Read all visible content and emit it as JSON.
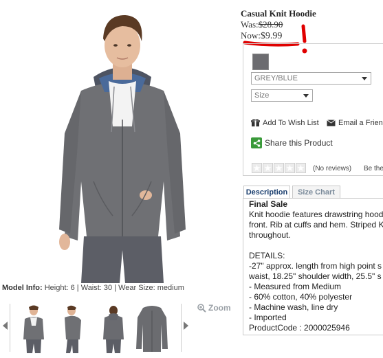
{
  "product": {
    "title": "Casual Knit Hoodie",
    "was_label": "Was:",
    "was_price": "$28.90",
    "now_label": "Now:",
    "now_price": "$9.99"
  },
  "gallery": {
    "model_info_label": "Model Info:",
    "model_info_text": "Height: 6 | Waist: 30 | Wear Size: medium",
    "zoom_label": "Zoom"
  },
  "options": {
    "color_select": "GREY/BLUE",
    "size_select": "Size",
    "swatch_color": "#6c6c70"
  },
  "actions": {
    "wishlist": "Add To Wish List",
    "email": "Email a Friend",
    "share": "Share this Product"
  },
  "rating": {
    "reviews": "(No reviews)",
    "be_first": "Be the first"
  },
  "tabs": {
    "description": "Description",
    "size_chart": "Size Chart"
  },
  "description": {
    "heading": "Final Sale",
    "lines": [
      "Knit hoodie features drawstring hood",
      "front. Rib at cuffs and hem. Striped K",
      "throughout.",
      "",
      "DETAILS:",
      "-27\" approx. length from high point s",
      "waist, 18.25\" shoulder width, 25.5\" s",
      "- Measured from Medium",
      "- 60% cotton, 40% polyester",
      "- Machine wash, line dry",
      "- Imported",
      "ProductCode : 2000025946"
    ]
  },
  "colors": {
    "annotation_red": "#e00000",
    "tab_active": "#1a3e6e",
    "share_green": "#3a9a3a"
  }
}
